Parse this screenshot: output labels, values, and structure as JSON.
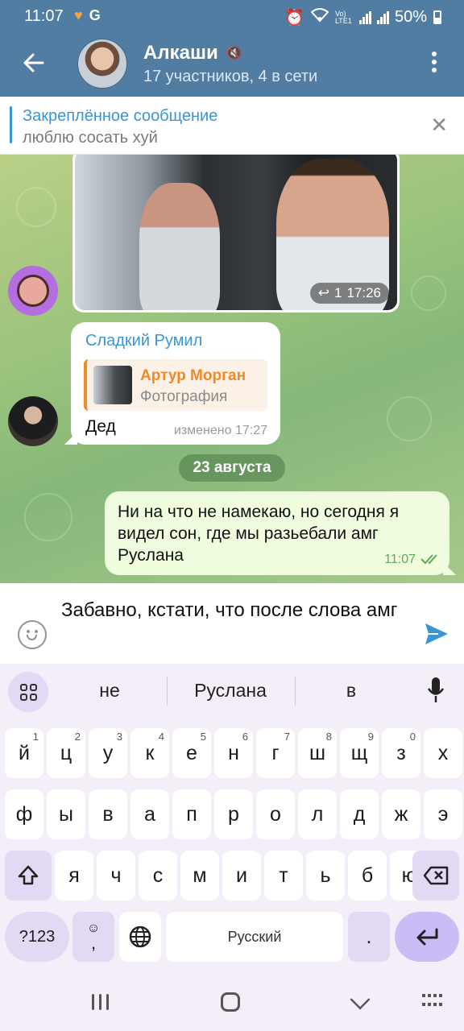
{
  "status_bar": {
    "time": "11:07",
    "battery": "50%",
    "network_label": "Vo) LTE1"
  },
  "header": {
    "title": "Алкаши",
    "subtitle": "17 участников, 4 в сети",
    "background_color": "#517da2"
  },
  "pinned": {
    "title": "Закреплённое сообщение",
    "text": "люблю сосать хуй"
  },
  "messages": {
    "photo": {
      "reply_count": "1",
      "time": "17:26"
    },
    "incoming": {
      "sender": "Сладкий Румил",
      "reply_author": "Артур Морган",
      "reply_text": "Фотография",
      "text": "Дед",
      "meta": "изменено 17:27"
    },
    "date_separator": "23 августа",
    "outgoing": {
      "text": "Ни на что не намекаю, но сегодня я видел сон, где мы разьебали амг Руслана",
      "time": "11:07"
    }
  },
  "composer": {
    "value": "Забавно, кстати, что после слова амг"
  },
  "keyboard": {
    "suggestions": [
      "не",
      "Руслана",
      "в"
    ],
    "row1": [
      {
        "k": "й",
        "n": "1"
      },
      {
        "k": "ц",
        "n": "2"
      },
      {
        "k": "у",
        "n": "3"
      },
      {
        "k": "к",
        "n": "4"
      },
      {
        "k": "е",
        "n": "5"
      },
      {
        "k": "н",
        "n": "6"
      },
      {
        "k": "г",
        "n": "7"
      },
      {
        "k": "ш",
        "n": "8"
      },
      {
        "k": "щ",
        "n": "9"
      },
      {
        "k": "з",
        "n": "0"
      },
      {
        "k": "х",
        "n": ""
      }
    ],
    "row2": [
      "ф",
      "ы",
      "в",
      "а",
      "п",
      "р",
      "о",
      "л",
      "д",
      "ж",
      "э"
    ],
    "row3": [
      "я",
      "ч",
      "с",
      "м",
      "и",
      "т",
      "ь",
      "б",
      "ю"
    ],
    "symbols_label": "?123",
    "space_label": "Русский",
    "period_label": ".",
    "comma_label": ","
  },
  "icons": [
    "back-arrow-icon",
    "mute-icon",
    "more-vert-icon",
    "close-icon",
    "reply-icon",
    "double-check-icon",
    "emoji-icon",
    "send-icon",
    "apps-icon",
    "mic-icon",
    "shift-icon",
    "backspace-icon",
    "globe-icon",
    "enter-icon",
    "recents-icon",
    "home-icon",
    "nav-back-icon",
    "keyboard-hide-icon"
  ]
}
